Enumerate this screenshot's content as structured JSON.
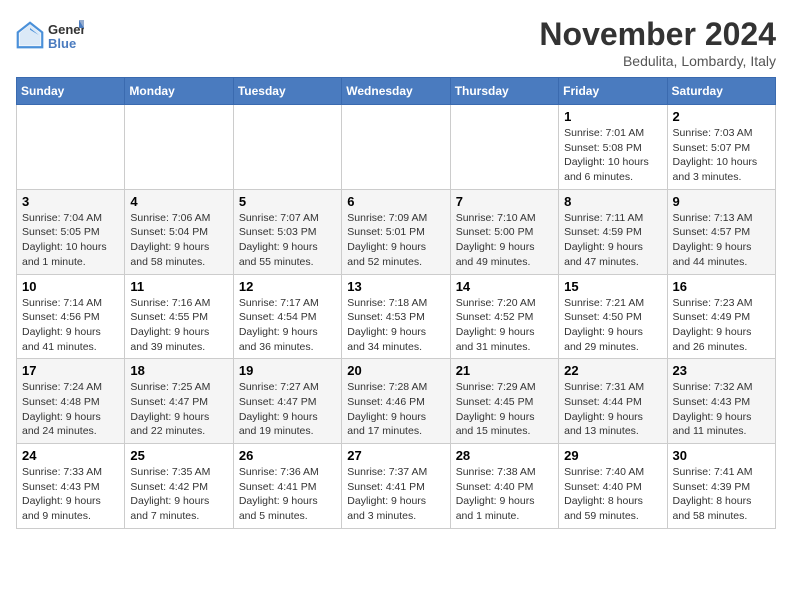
{
  "header": {
    "logo_line1": "General",
    "logo_line2": "Blue",
    "month": "November 2024",
    "location": "Bedulita, Lombardy, Italy"
  },
  "weekdays": [
    "Sunday",
    "Monday",
    "Tuesday",
    "Wednesday",
    "Thursday",
    "Friday",
    "Saturday"
  ],
  "weeks": [
    [
      {
        "day": "",
        "info": ""
      },
      {
        "day": "",
        "info": ""
      },
      {
        "day": "",
        "info": ""
      },
      {
        "day": "",
        "info": ""
      },
      {
        "day": "",
        "info": ""
      },
      {
        "day": "1",
        "info": "Sunrise: 7:01 AM\nSunset: 5:08 PM\nDaylight: 10 hours and 6 minutes."
      },
      {
        "day": "2",
        "info": "Sunrise: 7:03 AM\nSunset: 5:07 PM\nDaylight: 10 hours and 3 minutes."
      }
    ],
    [
      {
        "day": "3",
        "info": "Sunrise: 7:04 AM\nSunset: 5:05 PM\nDaylight: 10 hours and 1 minute."
      },
      {
        "day": "4",
        "info": "Sunrise: 7:06 AM\nSunset: 5:04 PM\nDaylight: 9 hours and 58 minutes."
      },
      {
        "day": "5",
        "info": "Sunrise: 7:07 AM\nSunset: 5:03 PM\nDaylight: 9 hours and 55 minutes."
      },
      {
        "day": "6",
        "info": "Sunrise: 7:09 AM\nSunset: 5:01 PM\nDaylight: 9 hours and 52 minutes."
      },
      {
        "day": "7",
        "info": "Sunrise: 7:10 AM\nSunset: 5:00 PM\nDaylight: 9 hours and 49 minutes."
      },
      {
        "day": "8",
        "info": "Sunrise: 7:11 AM\nSunset: 4:59 PM\nDaylight: 9 hours and 47 minutes."
      },
      {
        "day": "9",
        "info": "Sunrise: 7:13 AM\nSunset: 4:57 PM\nDaylight: 9 hours and 44 minutes."
      }
    ],
    [
      {
        "day": "10",
        "info": "Sunrise: 7:14 AM\nSunset: 4:56 PM\nDaylight: 9 hours and 41 minutes."
      },
      {
        "day": "11",
        "info": "Sunrise: 7:16 AM\nSunset: 4:55 PM\nDaylight: 9 hours and 39 minutes."
      },
      {
        "day": "12",
        "info": "Sunrise: 7:17 AM\nSunset: 4:54 PM\nDaylight: 9 hours and 36 minutes."
      },
      {
        "day": "13",
        "info": "Sunrise: 7:18 AM\nSunset: 4:53 PM\nDaylight: 9 hours and 34 minutes."
      },
      {
        "day": "14",
        "info": "Sunrise: 7:20 AM\nSunset: 4:52 PM\nDaylight: 9 hours and 31 minutes."
      },
      {
        "day": "15",
        "info": "Sunrise: 7:21 AM\nSunset: 4:50 PM\nDaylight: 9 hours and 29 minutes."
      },
      {
        "day": "16",
        "info": "Sunrise: 7:23 AM\nSunset: 4:49 PM\nDaylight: 9 hours and 26 minutes."
      }
    ],
    [
      {
        "day": "17",
        "info": "Sunrise: 7:24 AM\nSunset: 4:48 PM\nDaylight: 9 hours and 24 minutes."
      },
      {
        "day": "18",
        "info": "Sunrise: 7:25 AM\nSunset: 4:47 PM\nDaylight: 9 hours and 22 minutes."
      },
      {
        "day": "19",
        "info": "Sunrise: 7:27 AM\nSunset: 4:47 PM\nDaylight: 9 hours and 19 minutes."
      },
      {
        "day": "20",
        "info": "Sunrise: 7:28 AM\nSunset: 4:46 PM\nDaylight: 9 hours and 17 minutes."
      },
      {
        "day": "21",
        "info": "Sunrise: 7:29 AM\nSunset: 4:45 PM\nDaylight: 9 hours and 15 minutes."
      },
      {
        "day": "22",
        "info": "Sunrise: 7:31 AM\nSunset: 4:44 PM\nDaylight: 9 hours and 13 minutes."
      },
      {
        "day": "23",
        "info": "Sunrise: 7:32 AM\nSunset: 4:43 PM\nDaylight: 9 hours and 11 minutes."
      }
    ],
    [
      {
        "day": "24",
        "info": "Sunrise: 7:33 AM\nSunset: 4:43 PM\nDaylight: 9 hours and 9 minutes."
      },
      {
        "day": "25",
        "info": "Sunrise: 7:35 AM\nSunset: 4:42 PM\nDaylight: 9 hours and 7 minutes."
      },
      {
        "day": "26",
        "info": "Sunrise: 7:36 AM\nSunset: 4:41 PM\nDaylight: 9 hours and 5 minutes."
      },
      {
        "day": "27",
        "info": "Sunrise: 7:37 AM\nSunset: 4:41 PM\nDaylight: 9 hours and 3 minutes."
      },
      {
        "day": "28",
        "info": "Sunrise: 7:38 AM\nSunset: 4:40 PM\nDaylight: 9 hours and 1 minute."
      },
      {
        "day": "29",
        "info": "Sunrise: 7:40 AM\nSunset: 4:40 PM\nDaylight: 8 hours and 59 minutes."
      },
      {
        "day": "30",
        "info": "Sunrise: 7:41 AM\nSunset: 4:39 PM\nDaylight: 8 hours and 58 minutes."
      }
    ]
  ]
}
